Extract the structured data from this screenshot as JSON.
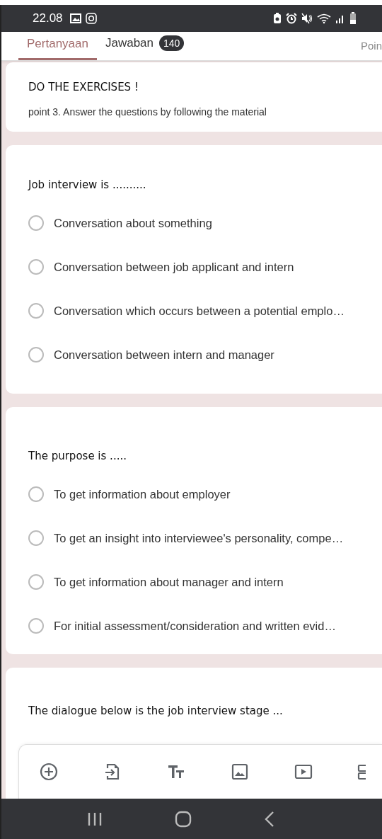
{
  "status_bar": {
    "time": "22.08"
  },
  "tabs": [
    {
      "label": "Pertanyaan",
      "selected": true
    },
    {
      "label": "Jawaban",
      "selected": false,
      "badge": "140"
    }
  ],
  "points_label": "Poin",
  "header": {
    "title": "DO THE EXERCISES !",
    "description": "point 3. Answer the questions by following the material"
  },
  "questions": [
    {
      "title": "Job interview is ..........",
      "options": [
        {
          "label": "Conversation about something",
          "selected": false
        },
        {
          "label": "Conversation between job applicant and intern",
          "selected": false
        },
        {
          "label": "Conversation which occurs between a potential emplo…",
          "selected": false
        },
        {
          "label": "Conversation between intern and manager",
          "selected": false
        }
      ]
    },
    {
      "title": "The purpose is .....",
      "options": [
        {
          "label": "To get information about employer",
          "selected": false
        },
        {
          "label": "To get an insight into interviewee's personality, compe…",
          "selected": false
        },
        {
          "label": "To get information about manager and intern",
          "selected": false
        },
        {
          "label": "For initial assessment/consideration and written evid…",
          "selected": false
        }
      ]
    },
    {
      "title": "The dialogue below is the job interview stage ..."
    }
  ]
}
